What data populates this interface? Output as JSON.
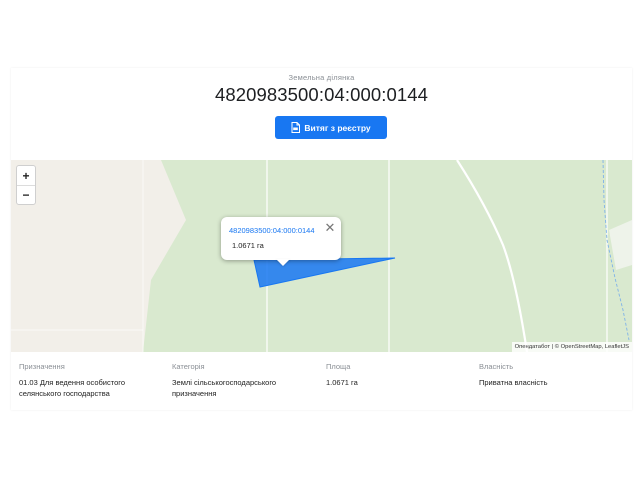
{
  "header": {
    "subtitle": "Земельна ділянка",
    "cadastral_number": "4820983500:04:000:0144",
    "extract_button_label": "Витяг з реєстру"
  },
  "map": {
    "zoom_in_label": "+",
    "zoom_out_label": "−",
    "popup": {
      "title": "4820983500:04:000:0144",
      "area": "1.0671 га",
      "close": "✕"
    },
    "attribution": "Опендатабот | © OpenStreetMap, LeafletJS",
    "colors": {
      "farmland": "#f2efe9",
      "forest": "#d9e9cf",
      "parcel": "#1877f2",
      "road": "#ffffff",
      "water_line": "#7fb2e8"
    }
  },
  "info": [
    {
      "label": "Призначення",
      "value": "01.03 Для ведення особистого селянського господарства"
    },
    {
      "label": "Категорія",
      "value": "Землі сільськогосподарського призначення"
    },
    {
      "label": "Площа",
      "value": "1.0671 га"
    },
    {
      "label": "Власність",
      "value": "Приватна власність"
    }
  ],
  "colors": {
    "accent": "#1877f2"
  }
}
